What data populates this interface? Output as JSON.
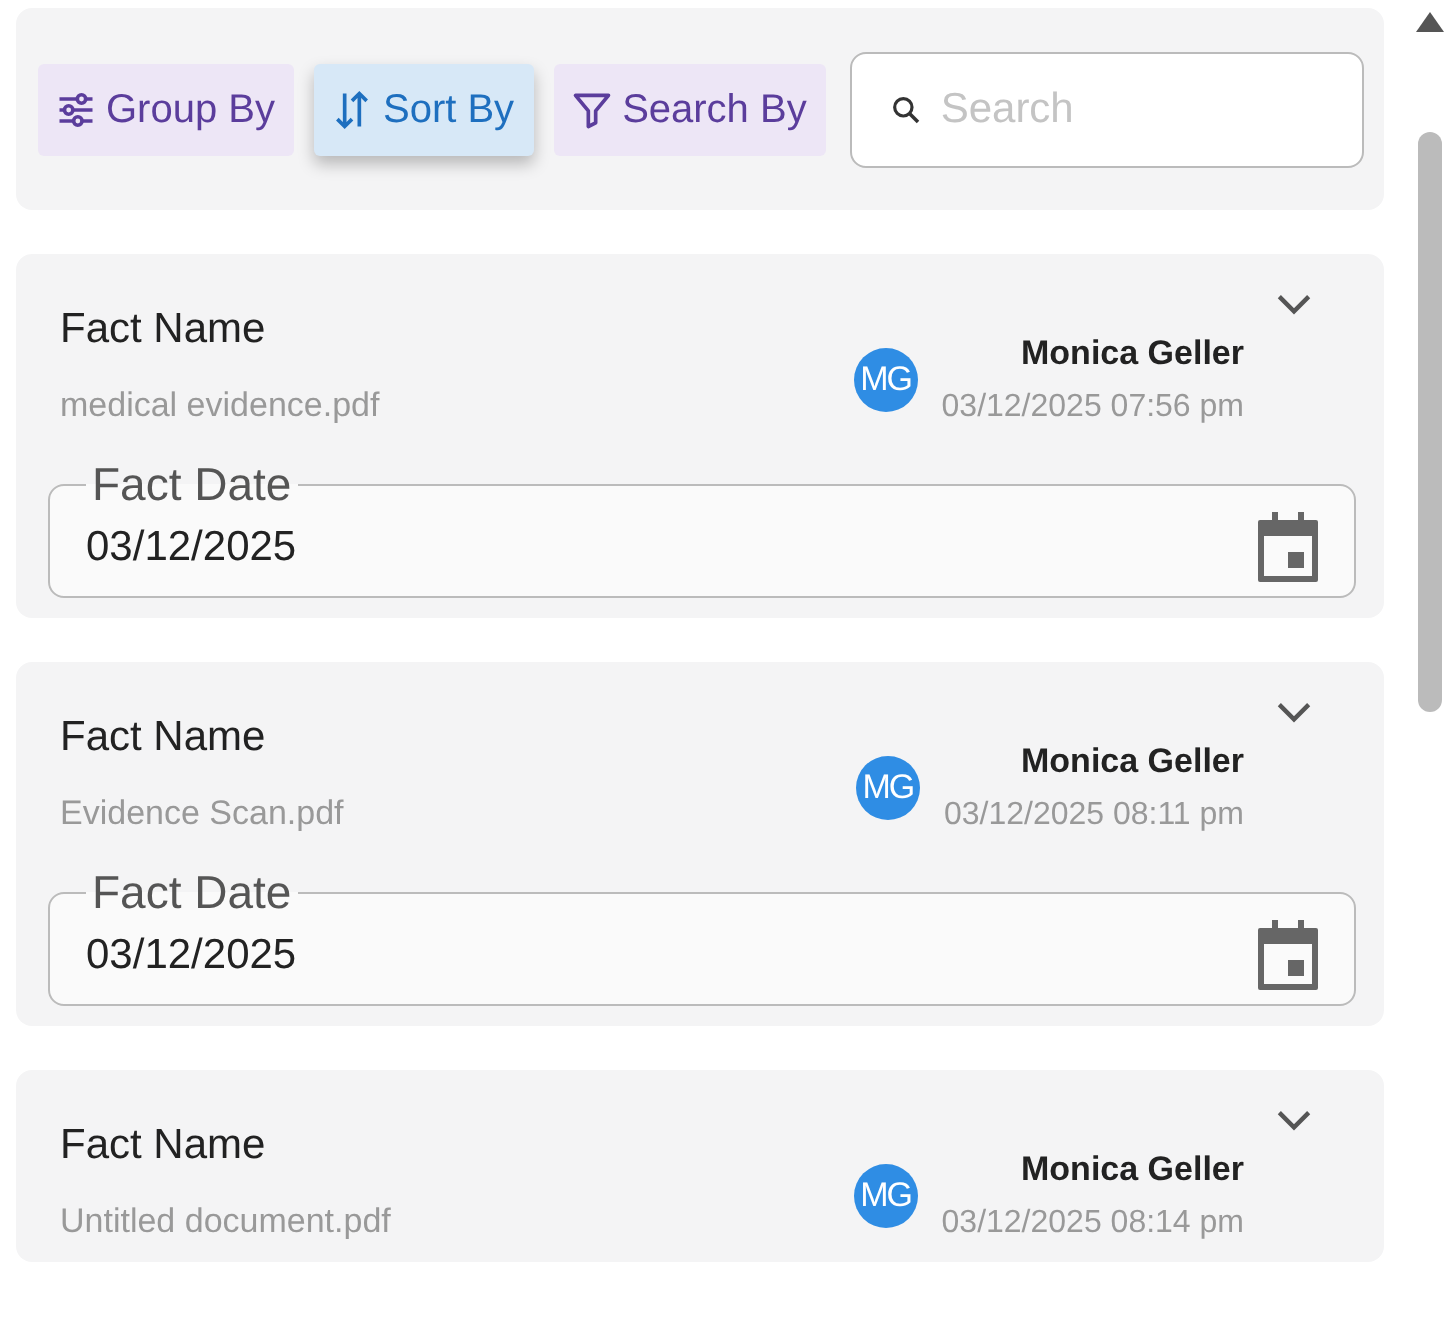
{
  "toolbar": {
    "buttons": [
      {
        "label": "Group By",
        "kind": "group",
        "selected": false
      },
      {
        "label": "Sort By",
        "kind": "sort",
        "selected": true
      },
      {
        "label": "Search By",
        "kind": "filter",
        "selected": false
      }
    ],
    "search": {
      "placeholder": "Search"
    }
  },
  "facts": [
    {
      "title": "Fact Name",
      "file": "medical evidence.pdf",
      "avatar": "MG",
      "user": "Monica Geller",
      "timestamp": "03/12/2025 07:56 pm",
      "date_label": "Fact Date",
      "date_value": "03/12/2025"
    },
    {
      "title": "Fact Name",
      "file": "Evidence Scan.pdf",
      "avatar": "MG",
      "user": "Monica Geller",
      "timestamp": "03/12/2025 08:11 pm",
      "date_label": "Fact Date",
      "date_value": "03/12/2025"
    },
    {
      "title": "Fact Name",
      "file": "Untitled document.pdf",
      "avatar": "MG",
      "user": "Monica Geller",
      "timestamp": "03/12/2025 08:14 pm"
    }
  ]
}
